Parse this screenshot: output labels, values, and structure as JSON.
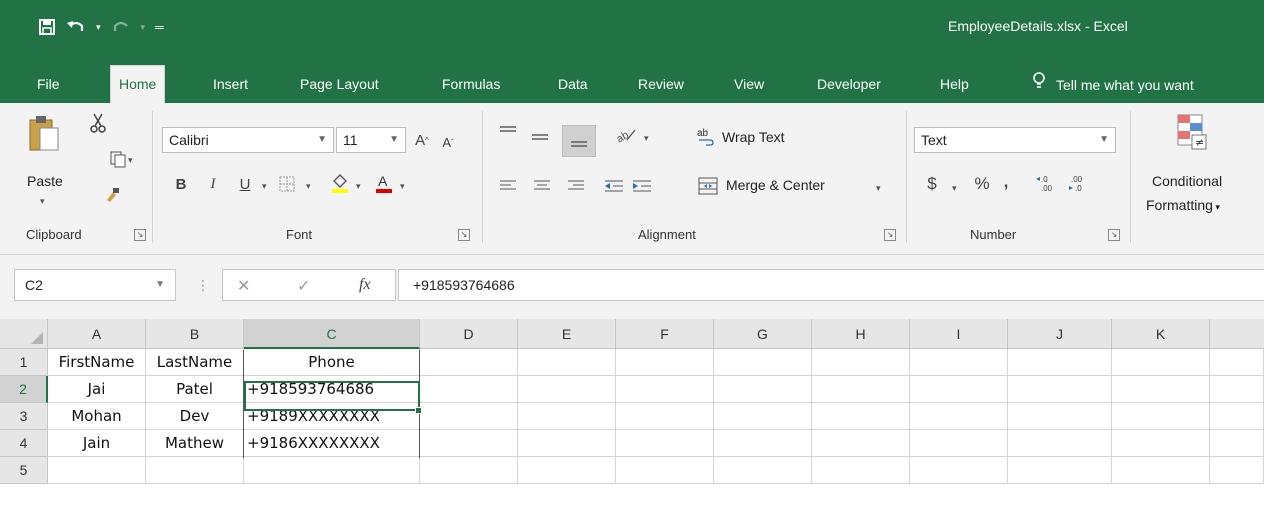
{
  "window": {
    "title": "EmployeeDetails.xlsx - Excel"
  },
  "tabs": [
    {
      "label": "File"
    },
    {
      "label": "Home"
    },
    {
      "label": "Insert"
    },
    {
      "label": "Page Layout"
    },
    {
      "label": "Formulas"
    },
    {
      "label": "Data"
    },
    {
      "label": "Review"
    },
    {
      "label": "View"
    },
    {
      "label": "Developer"
    },
    {
      "label": "Help"
    }
  ],
  "tell_me": "Tell me what you want",
  "ribbon": {
    "clipboard": {
      "paste": "Paste",
      "label": "Clipboard"
    },
    "font": {
      "name": "Calibri",
      "size": "11",
      "bold": "B",
      "italic": "I",
      "underline": "U",
      "label": "Font"
    },
    "alignment": {
      "wrap": "Wrap Text",
      "merge": "Merge & Center",
      "label": "Alignment"
    },
    "number": {
      "format": "Text",
      "currency": "$",
      "percent": "%",
      "comma": ",",
      "label": "Number"
    },
    "styles": {
      "conditional_line1": "Conditional",
      "conditional_line2": "Formatting"
    }
  },
  "formula_bar": {
    "name_box": "C2",
    "fx": "fx",
    "value": "+918593764686"
  },
  "grid": {
    "columns": [
      "A",
      "B",
      "C",
      "D",
      "E",
      "F",
      "G",
      "H",
      "I",
      "J",
      "K"
    ],
    "rows": [
      "1",
      "2",
      "3",
      "4",
      "5"
    ],
    "cells": [
      [
        "FirstName",
        "LastName",
        "Phone"
      ],
      [
        "Jai",
        "Patel",
        "+918593764686"
      ],
      [
        "Mohan",
        "Dev",
        "+9189XXXXXXXX"
      ],
      [
        "Jain",
        "Mathew",
        "+9186XXXXXXXX"
      ],
      [
        "",
        "",
        ""
      ]
    ]
  },
  "colors": {
    "accent": "#217346",
    "ribbon_bg": "#f3f3f3",
    "header_bg": "#e6e6e6"
  }
}
